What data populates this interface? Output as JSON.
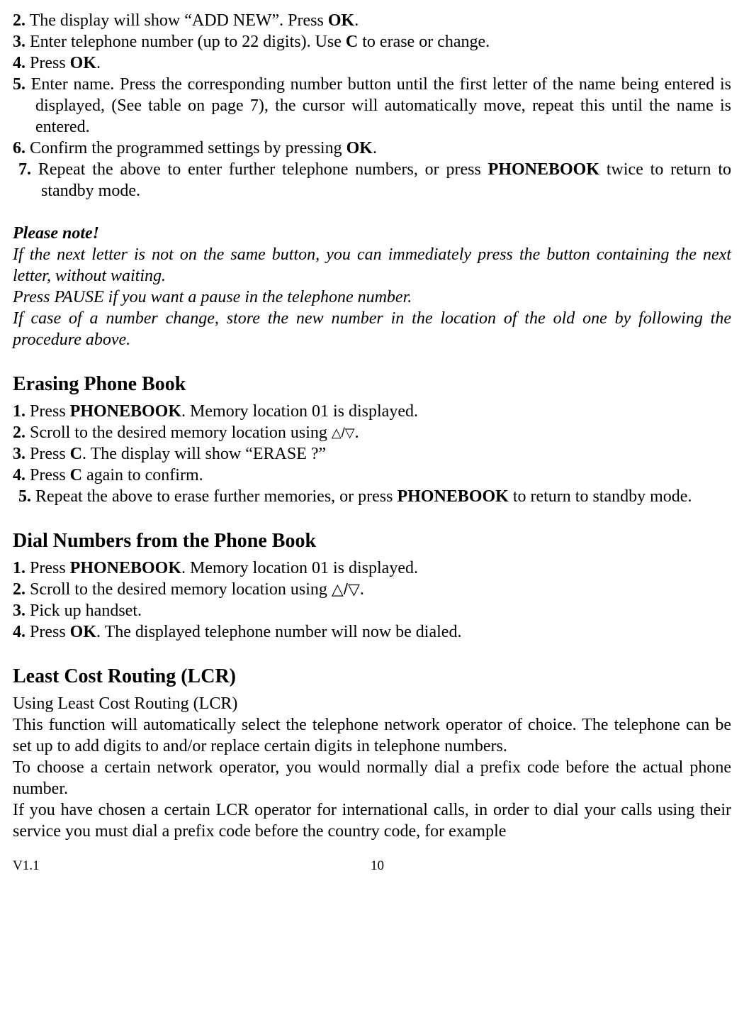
{
  "top_steps": {
    "s2": {
      "num": "2.",
      "text_a": " The display will show “ADD NEW”. Press ",
      "bold_b": "OK",
      "text_c": "."
    },
    "s3": {
      "num": "3.",
      "text_a": " Enter telephone number (up to 22 digits). Use ",
      "bold_b": "C",
      "text_c": " to erase or change."
    },
    "s4": {
      "num": "4.",
      "text_a": " Press ",
      "bold_b": "OK",
      "text_c": "."
    },
    "s5": {
      "num": "5.",
      "text": " Enter name. Press the corresponding number button until the first letter of the name being entered is displayed, (See table on page 7), the cursor will automatically move, repeat this until the name is entered."
    },
    "s6": {
      "num": "6.",
      "text_a": " Confirm the programmed settings by pressing ",
      "bold_b": "OK",
      "text_c": "."
    },
    "s7": {
      "num": "7.",
      "text_a": " Repeat the above to enter further telephone numbers, or press ",
      "bold_b": "PHONEBOOK",
      "text_c": " twice to return to standby mode."
    }
  },
  "note": {
    "title": "Please note!",
    "p1": "If the next letter is not on the same button, you can immediately press the button containing the next letter, without waiting.",
    "p2": "Press PAUSE if you want a pause in the telephone number.",
    "p3": "If case of a number change, store the new number in the location of the old one by following the procedure above."
  },
  "erase": {
    "heading": "Erasing Phone Book",
    "s1": {
      "num": "1.",
      "text_a": " Press ",
      "bold_b": "PHONEBOOK",
      "text_c": ". Memory location 01 is displayed."
    },
    "s2": {
      "num": "2.",
      "text_a": " Scroll to the desired memory location using  ",
      "text_c": "."
    },
    "s3": {
      "num": "3.",
      "text_a": " Press ",
      "bold_b": "C",
      "text_c": ". The display will show “ERASE ?”"
    },
    "s4": {
      "num": "4.",
      "text_a": " Press ",
      "bold_b": "C",
      "text_c": " again to confirm."
    },
    "s5": {
      "num": "5.",
      "text_a": " Repeat the above to erase further memories, or press ",
      "bold_b": "PHONEBOOK",
      "text_c": " to return to standby mode."
    }
  },
  "dial": {
    "heading": "Dial Numbers from the Phone Book",
    "s1": {
      "num": "1.",
      "text_a": " Press ",
      "bold_b": "PHONEBOOK",
      "text_c": ". Memory location 01 is displayed."
    },
    "s2": {
      "num": "2.",
      "text_a": "  Scroll to the desired memory location using ",
      "text_c": "."
    },
    "s3": {
      "num": "3.",
      "text": "  Pick up handset."
    },
    "s4": {
      "num": "4.",
      "text_a": " Press ",
      "bold_b": "OK",
      "text_c": ". The displayed telephone number will now be dialed."
    }
  },
  "lcr": {
    "heading": "Least Cost Routing (LCR)",
    "sub": "Using Least Cost Routing (LCR)",
    "p1": "This function will automatically select the telephone network operator of choice. The telephone can be set up to add digits to and/or replace certain digits in telephone numbers.",
    "p2": "To choose a certain network operator, you would normally dial a prefix code before the actual phone number.",
    "p3": "If you have chosen a certain LCR operator for international calls, in order to dial your calls using their service you must dial a prefix code before the country code, for example"
  },
  "footer": {
    "version": "V1.1",
    "page": "10"
  },
  "icons": {
    "updown_small": "△/▽",
    "updown_big": "△/▽"
  }
}
